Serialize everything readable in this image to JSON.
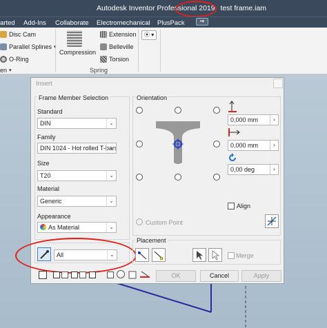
{
  "app": {
    "title": "Autodesk Inventor Professional 2019",
    "filename": "test frame.iam",
    "tabs": [
      "arted",
      "Add-Ins",
      "Collaborate",
      "Electromechanical",
      "PlusPack"
    ],
    "more_icon": "ellipsis-dropdown-icon"
  },
  "ribbon": {
    "items": [
      "Disc Cam",
      "Parallel Splines",
      "O-Ring"
    ],
    "spring_items": [
      "Extension",
      "Belleville",
      "Torsion"
    ],
    "compression": "Compression",
    "spring_panel": "Spring",
    "cut_label": "en",
    "dropdown_symbol": "⦿ ▾"
  },
  "dialog": {
    "title": "Insert",
    "frame_member_selection": "Frame Member Selection",
    "standard_label": "Standard",
    "standard_value": "DIN",
    "family_label": "Family",
    "family_value": "DIN 1024 - Hot rolled T-bars",
    "size_label": "Size",
    "size_value": "T20",
    "material_label": "Material",
    "material_value": "Generic",
    "appearance_label": "Appearance",
    "appearance_value": "As Material",
    "filter_value": "All",
    "orientation_label": "Orientation",
    "offset_x": "0,000 mm",
    "offset_y": "0,000 mm",
    "rotation": "0,00 deg",
    "align_label": "Align",
    "custom_point": "Custom Point",
    "placement_label": "Placement",
    "merge_label": "Merge",
    "ok_label": "OK",
    "cancel_label": "Cancel",
    "apply_label": "Apply"
  },
  "colors": {
    "title_bg": "#3a4a5c",
    "annotation_red": "#e0201b",
    "profile_gray": "#999999",
    "frame_line": "#2a2a9c"
  }
}
